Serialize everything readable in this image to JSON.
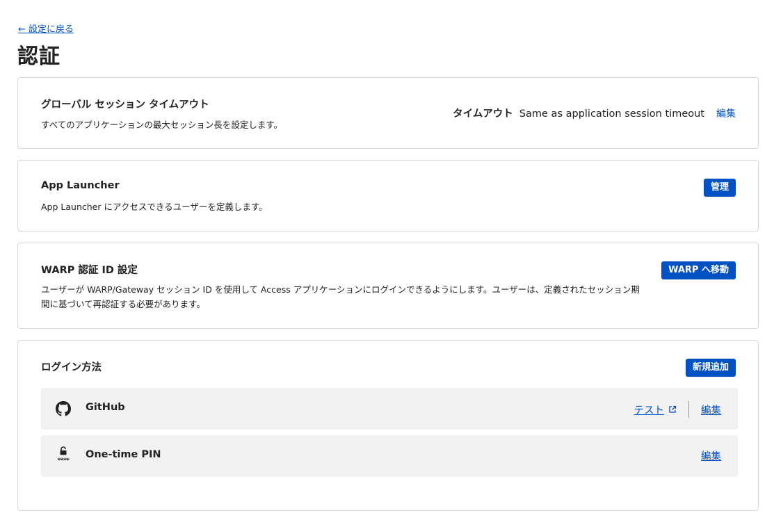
{
  "nav": {
    "back_label": "← 設定に戻る"
  },
  "page": {
    "title": "認証"
  },
  "timeout_card": {
    "title": "グローバル セッション タイムアウト",
    "description": "すべてのアプリケーションの最大セッション長を設定します。",
    "setting_label": "タイムアウト",
    "setting_value": "Same as application session timeout",
    "edit_label": "編集"
  },
  "launcher_card": {
    "title": "App Launcher",
    "description": "App Launcher にアクセスできるユーザーを定義します。",
    "button_label": "管理"
  },
  "warp_card": {
    "title": "WARP 認証 ID 設定",
    "description": "ユーザーが WARP/Gateway セッション ID を使用して Access アプリケーションにログインできるようにします。ユーザーは、定義されたセッション期間に基づいて再認証する必要があります。",
    "button_label": "WARP へ移動"
  },
  "login_card": {
    "title": "ログイン方法",
    "button_label": "新規追加",
    "methods": [
      {
        "name": "GitHub",
        "icon": "github-icon",
        "test_label": "テスト",
        "edit_label": "編集"
      },
      {
        "name": "One-time PIN",
        "icon": "unlocked-padlock-icon",
        "icon_caption": "****",
        "edit_label": "編集"
      }
    ]
  },
  "colors": {
    "accent": "#0051c3",
    "row_bg": "#f2f2f2",
    "border": "#d6d6d6"
  }
}
